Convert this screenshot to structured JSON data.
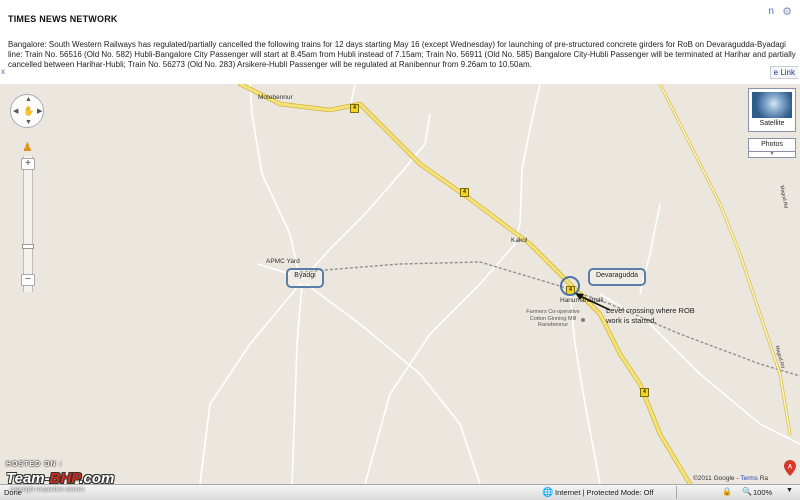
{
  "article": {
    "source": "TIMES NEWS NETWORK",
    "corner_letter": "n",
    "corner_icon": "gear-icon",
    "body": "Bangalore: South Western Railways has regulated/partially cancelled the following trains for 12 days starting May 16 (except Wednesday) for launching of pre-structured concrete girders for RoB on Devaragudda-Byadagi line: Train No. 56516 (Old No. 582) Hubli-Bangalore City Passenger will start at 8.45am from Hubli instead of 7.15am; Train No. 56911 (Old No. 585) Bangalore City-Hubli Passenger will be terminated at Harihar and partially cancelled between Harihar-Hubli; Train No. 56273 (Old No. 283) Arsikere-Hubli Passenger will be regulated at Ranibennur from 9.26am to 10.50am.",
    "left_fragment": "x",
    "link_label": "e Link"
  },
  "map": {
    "places": {
      "motebennur": "Motebennur",
      "kakol": "Kakol",
      "apmc": "APMC Yard",
      "byadgi": "Byadgi",
      "devaragudda": "Devaragudda",
      "hanumanahalli": "Hanumanahalli",
      "farmers": "Farmers Co-operative Cotton Ginning Mill Ranebennur",
      "road_a": "Magod Rd",
      "road_b": "Magod Rd"
    },
    "shield_label": "4",
    "annotation": "Level crossing where ROB work is started.",
    "controls": {
      "pan_up": "▲",
      "pan_down": "▼",
      "pan_left": "◀",
      "pan_right": "▶",
      "zoom_in": "+",
      "zoom_out": "−",
      "satellite": "Satellite",
      "photos": "Photos",
      "photos_chevron": "▼"
    },
    "copyright": "©2011 Google -",
    "terms": "Terms",
    "copyright_tail": "Ra"
  },
  "watermark": {
    "posted": "HOSTED ON :",
    "brand_a": "Team-",
    "brand_b": "BHP",
    "brand_c": ".com",
    "copy": "copyright respective owners"
  },
  "statusbar": {
    "left": "Done",
    "zone": "Internet | Protected Mode: Off",
    "zoom": "100%",
    "chevron": "▼"
  },
  "colors": {
    "map_bg": "#ece7de",
    "road_major": "#f5e27a",
    "road_edge": "#d1b53a",
    "road_minor": "#ffffff",
    "rail": "#8f8f8f",
    "highlight": "#5b7ea6"
  }
}
